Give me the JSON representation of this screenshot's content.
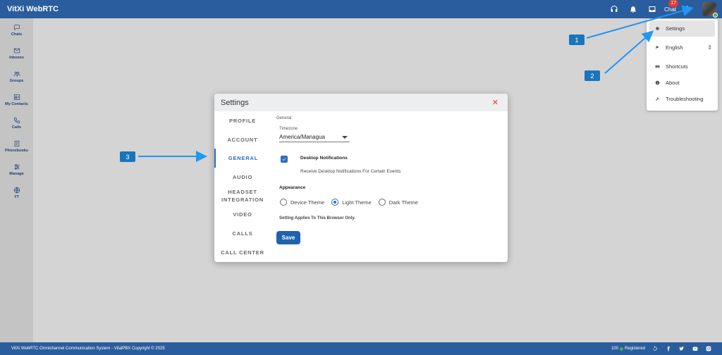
{
  "app": {
    "title": "VitXi WebRTC",
    "accent": "#2a5d9d"
  },
  "topbar": {
    "icons": [
      "headset-icon",
      "bell-icon",
      "inbox-icon",
      "chat-icon"
    ],
    "chat_label": "Chat",
    "chat_badge": "17",
    "more_label": "⋮"
  },
  "sidebar": {
    "items": [
      {
        "label": "Chats",
        "icon": "chat-bubble-icon"
      },
      {
        "label": "Inboxes",
        "icon": "envelope-icon"
      },
      {
        "label": "Groups",
        "icon": "group-icon"
      },
      {
        "label": "My Contacts",
        "icon": "contact-card-icon"
      },
      {
        "label": "Calls",
        "icon": "phone-icon"
      },
      {
        "label": "Phonebooks",
        "icon": "phonebook-icon"
      },
      {
        "label": "Manage",
        "icon": "sliders-icon"
      },
      {
        "label": "YT",
        "icon": "globe-icon"
      }
    ]
  },
  "menu": {
    "items": [
      {
        "label": "Settings",
        "icon": "gear-icon"
      },
      {
        "label": "English",
        "icon": "flag-icon"
      },
      {
        "label": "Shortcuts",
        "icon": "keyboard-icon"
      },
      {
        "label": "About",
        "icon": "info-icon"
      },
      {
        "label": "Troubleshooting",
        "icon": "wrench-icon"
      }
    ],
    "english_chevron": "⌃⌄"
  },
  "callouts": [
    "1",
    "2",
    "3"
  ],
  "modal": {
    "title": "Settings",
    "close": "✕",
    "tabs": [
      "PROFILE",
      "ACCOUNT",
      "GENERAL",
      "AUDIO",
      "HEADSET INTEGRATION",
      "VIDEO",
      "CALLS",
      "CALL CENTER"
    ],
    "active_tab": "GENERAL",
    "section": "General",
    "timezone_label": "Timezone",
    "timezone_value": "America/Managua",
    "notif_title": "Desktop Notifications",
    "notif_desc": "Receive Desktop Notifications For Certain Events",
    "notif_checked": true,
    "appearance_label": "Appearance",
    "themes": [
      "Device Theme",
      "Light Theme",
      "Dark Theme"
    ],
    "selected_theme": "Light Theme",
    "applies_note": "Setting Applies To This Browser Only.",
    "save_label": "Save"
  },
  "footer": {
    "copyright": "VitXi WebRTC Omnichannel Communication System - VitalPBX Copyright © 2025",
    "extension": "100",
    "status": "Registered"
  }
}
